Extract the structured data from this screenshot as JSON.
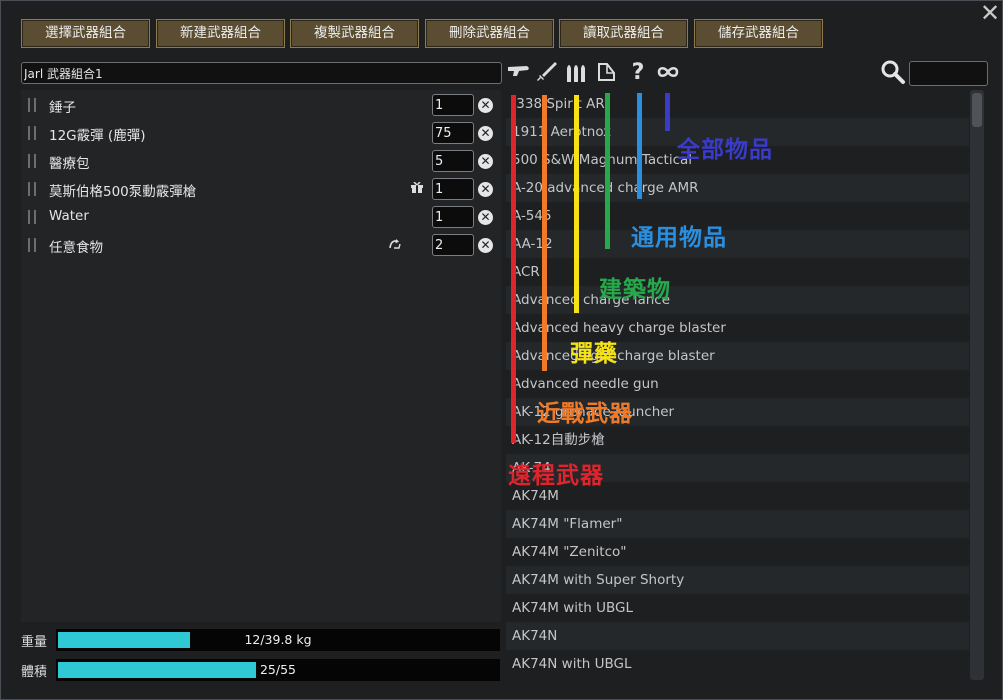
{
  "close_label": "✕",
  "toolbar": {
    "buttons": [
      "選擇武器組合",
      "新建武器組合",
      "複製武器組合",
      "刪除武器組合",
      "讀取武器組合",
      "儲存武器組合"
    ]
  },
  "loadout": {
    "name": "Jarl 武器組合1",
    "items": [
      {
        "label": "錘子",
        "qty": "1"
      },
      {
        "label": "12G霰彈 (鹿彈)",
        "qty": "75"
      },
      {
        "label": "醫療包",
        "qty": "5"
      },
      {
        "label": "莫斯伯格500泵動霰彈槍",
        "qty": "1",
        "icon": "gift-icon"
      },
      {
        "label": "Water",
        "qty": "1"
      },
      {
        "label": "任意食物",
        "qty": "2",
        "icon": "recycle-icon"
      }
    ]
  },
  "stats": {
    "weight_label": "重量",
    "weight_text": "12/39.8 kg",
    "weight_fraction": 0.3,
    "volume_label": "體積",
    "volume_text": "25/55",
    "volume_fraction": 0.45
  },
  "categories": {
    "icons": [
      "ranged-weapon-icon",
      "melee-weapon-icon",
      "ammo-icon",
      "building-icon",
      "question-icon",
      "infinity-icon"
    ]
  },
  "search": {
    "value": ""
  },
  "item_list": [
    ".338 Spirit AR",
    "1911 Aerotnox",
    "500 S&W Magnum Tactical",
    "A-20 advanced charge AMR",
    "A-545",
    "AA-12",
    "ACR",
    "Advanced charge lance",
    "Advanced heavy charge blaster",
    "Advanced light charge blaster",
    "Advanced needle gun",
    "AK-12 grenade launcher",
    "AK-12自動步槍",
    "AK-74",
    "AK74M",
    "AK74M \"Flamer\"",
    "AK74M \"Zenitco\"",
    "AK74M with Super Shorty",
    "AK74M with UBGL",
    "AK74N",
    "AK74N with UBGL"
  ],
  "annotations": [
    {
      "label": "遠程武器",
      "color": "#e0242c"
    },
    {
      "label": "近戰武器",
      "color": "#f07a28"
    },
    {
      "label": "彈藥",
      "color": "#f5e218"
    },
    {
      "label": "建築物",
      "color": "#27a84a"
    },
    {
      "label": "通用物品",
      "color": "#2b8fe0"
    },
    {
      "label": "全部物品",
      "color": "#3a3bc8"
    }
  ]
}
